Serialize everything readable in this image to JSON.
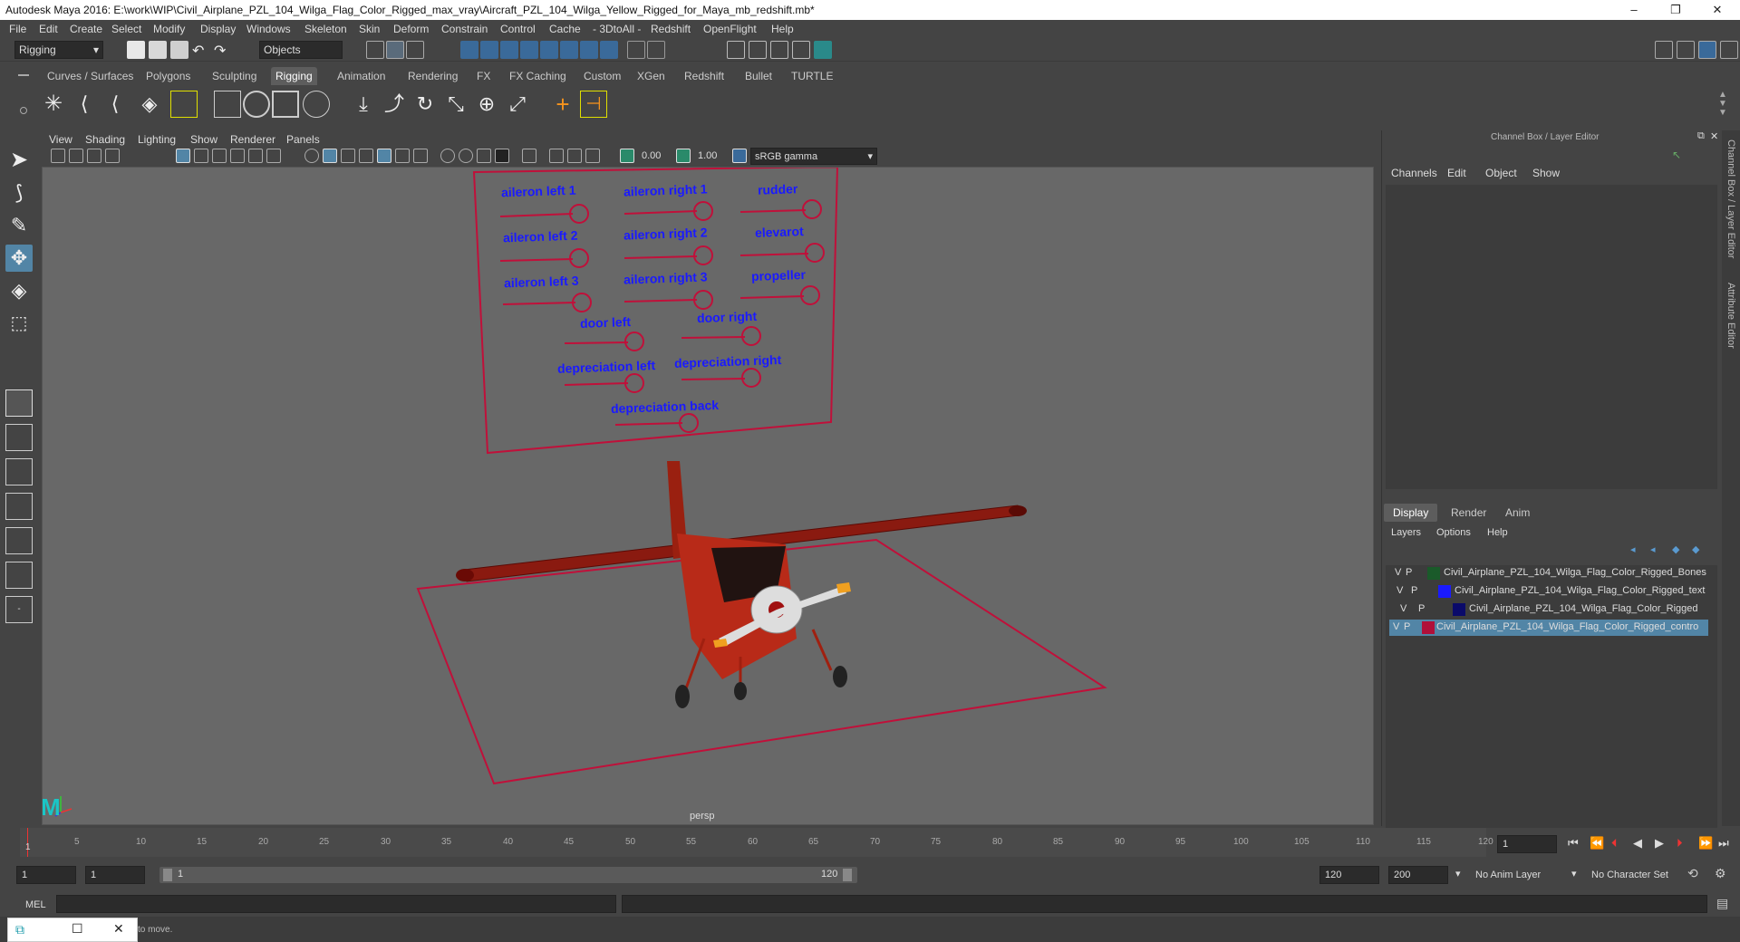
{
  "title": "Autodesk Maya 2016: E:\\work\\WIP\\Civil_Airplane_PZL_104_Wilga_Flag_Color_Rigged_max_vray\\Aircraft_PZL_104_Wilga_Yellow_Rigged_for_Maya_mb_redshift.mb*",
  "window_buttons": {
    "minimize": "–",
    "maximize": "❐",
    "close": "✕"
  },
  "menubar": [
    "File",
    "Edit",
    "Create",
    "Select",
    "Modify",
    "Display",
    "Windows",
    "Skeleton",
    "Skin",
    "Deform",
    "Constrain",
    "Control",
    "Cache",
    "- 3DtoAll -",
    "Redshift",
    "OpenFlight",
    "Help"
  ],
  "status": {
    "menuset": "Rigging",
    "selmask": "Objects"
  },
  "shelf_tabs": [
    "Curves / Surfaces",
    "Polygons",
    "Sculpting",
    "Rigging",
    "Animation",
    "Rendering",
    "FX",
    "FX Caching",
    "Custom",
    "XGen",
    "Redshift",
    "Bullet",
    "TURTLE"
  ],
  "shelf_active": "Rigging",
  "viewport_menu": [
    "View",
    "Shading",
    "Lighting",
    "Show",
    "Renderer",
    "Panels"
  ],
  "viewport_toolbar": {
    "exposure": "0.00",
    "gamma": "1.00",
    "colorspace": "sRGB gamma"
  },
  "viewport_label": "persp",
  "controls": {
    "aileron_left_1": "aileron left 1",
    "aileron_right_1": "aileron right 1",
    "rudder": "rudder",
    "aileron_left_2": "aileron left 2",
    "aileron_right_2": "aileron right 2",
    "elevator": "elevarot",
    "aileron_left_3": "aileron left 3",
    "aileron_right_3": "aileron right 3",
    "propeller": "propeller",
    "door_left": "door left",
    "door_right": "door right",
    "depreciation_left": "depreciation left",
    "depreciation_right": "depreciation right",
    "depreciation_back": "depreciation back"
  },
  "channel_box": {
    "title": "Channel Box / Layer Editor",
    "menus": [
      "Channels",
      "Edit",
      "Object",
      "Show"
    ],
    "layer_tabs": [
      "Display",
      "Render",
      "Anim"
    ],
    "layer_menus": [
      "Layers",
      "Options",
      "Help"
    ],
    "layers": [
      {
        "v": "V",
        "p": "P",
        "name": "Civil_Airplane_PZL_104_Wilga_Flag_Color_Rigged_Bones",
        "color": "#1a5a2a"
      },
      {
        "v": "V",
        "p": "P",
        "name": "Civil_Airplane_PZL_104_Wilga_Flag_Color_Rigged_text",
        "color": "#1a1aff"
      },
      {
        "v": "V",
        "p": "P",
        "name": "Civil_Airplane_PZL_104_Wilga_Flag_Color_Rigged",
        "color": "#0a0a6a"
      },
      {
        "v": "V",
        "p": "P",
        "name": "Civil_Airplane_PZL_104_Wilga_Flag_Color_Rigged_contro",
        "color": "#b0103a"
      }
    ]
  },
  "side_tabs": {
    "channel": "Channel Box / Layer Editor",
    "attr": "Attribute Editor"
  },
  "timeline": {
    "ticks": [
      "5",
      "10",
      "15",
      "20",
      "25",
      "30",
      "35",
      "40",
      "45",
      "50",
      "55",
      "60",
      "65",
      "70",
      "75",
      "80",
      "85",
      "90",
      "95",
      "100",
      "105",
      "110",
      "115",
      "120"
    ],
    "current_marker": "1",
    "current_frame": "1"
  },
  "range": {
    "start": "1",
    "playback_start": "1",
    "slider_start": "1",
    "slider_end": "120",
    "playback_end": "120",
    "end": "200",
    "anim_layer": "No Anim Layer",
    "char_set": "No Character Set"
  },
  "cmdline": {
    "label": "MEL"
  },
  "help_text": "to move."
}
